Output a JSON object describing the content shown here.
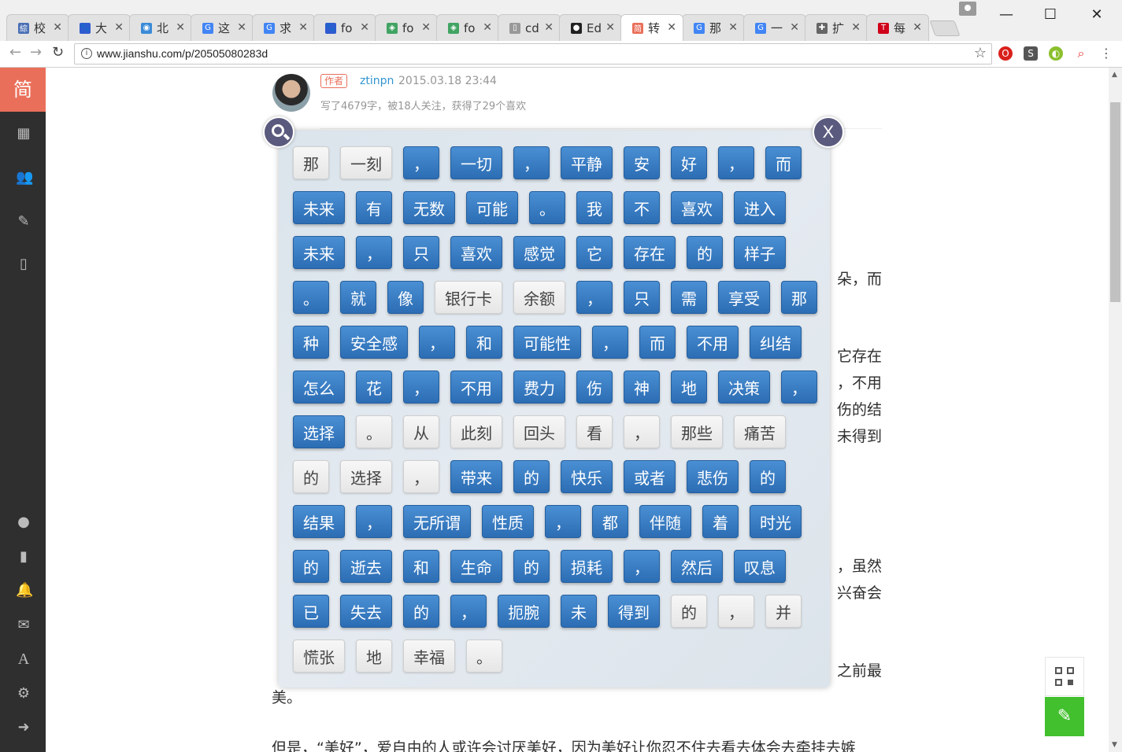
{
  "browser": {
    "tabs": [
      {
        "label": "校",
        "fav_color": "#4a6fb5",
        "fav": "綜"
      },
      {
        "label": "大",
        "fav_color": "#2f5bd0",
        "fav": "🐾"
      },
      {
        "label": "北",
        "fav_color": "#3a8ad8",
        "fav": "◉"
      },
      {
        "label": "这",
        "fav_color": "#4285f4",
        "fav": "G"
      },
      {
        "label": "求",
        "fav_color": "#4285f4",
        "fav": "G"
      },
      {
        "label": "fo",
        "fav_color": "#2f5bd0",
        "fav": "🐾"
      },
      {
        "label": "fo",
        "fav_color": "#41a463",
        "fav": "◈"
      },
      {
        "label": "fo",
        "fav_color": "#41a463",
        "fav": "◈"
      },
      {
        "label": "cd",
        "fav_color": "#999999",
        "fav": "▯"
      },
      {
        "label": "Ed",
        "fav_color": "#222222",
        "fav": "●"
      },
      {
        "label": "转",
        "fav_color": "#ea6f5a",
        "fav": "简"
      },
      {
        "label": "那",
        "fav_color": "#4285f4",
        "fav": "G"
      },
      {
        "label": "一",
        "fav_color": "#4285f4",
        "fav": "G"
      },
      {
        "label": "扩",
        "fav_color": "#666666",
        "fav": "✚"
      },
      {
        "label": "每",
        "fav_color": "#d0021b",
        "fav": "T"
      }
    ],
    "active_tab_index": 10,
    "url": "www.jianshu.com/p/20505080283d",
    "window_buttons": {
      "minimize": "—",
      "maximize": "☐",
      "close": "✕"
    }
  },
  "sidebar": {
    "logo": "简"
  },
  "article": {
    "author_badge": "作者",
    "author_name": "ztinpn",
    "date": "2015.03.18 23:44",
    "stats": "写了4679字，被18人关注，获得了29个喜欢",
    "fragments": {
      "r1": "朵，而",
      "r2": "它存在",
      "r3": "，不用",
      "r4": "伤的结",
      "r5": "未得到",
      "r6": "，虽然",
      "r7": "兴奋会",
      "r8": "之前最",
      "r9": "美。",
      "r10": "但是，“美好”，爱自由的人或许会讨厌美好，因为美好让你忍不住去看去体会去牵挂去嫉"
    }
  },
  "overlay": {
    "rows": [
      [
        {
          "t": "那",
          "on": false
        },
        {
          "t": "一刻",
          "on": false
        },
        {
          "t": "，",
          "on": true
        },
        {
          "t": "一切",
          "on": true
        },
        {
          "t": "，",
          "on": true
        },
        {
          "t": "平静",
          "on": true
        },
        {
          "t": "安",
          "on": true
        },
        {
          "t": "好",
          "on": true
        },
        {
          "t": "，",
          "on": true
        },
        {
          "t": "而",
          "on": true
        }
      ],
      [
        {
          "t": "未来",
          "on": true
        },
        {
          "t": "有",
          "on": true
        },
        {
          "t": "无数",
          "on": true
        },
        {
          "t": "可能",
          "on": true
        },
        {
          "t": "。",
          "on": true
        },
        {
          "t": "我",
          "on": true
        },
        {
          "t": "不",
          "on": true
        },
        {
          "t": "喜欢",
          "on": true
        },
        {
          "t": "进入",
          "on": true
        }
      ],
      [
        {
          "t": "未来",
          "on": true
        },
        {
          "t": "，",
          "on": true
        },
        {
          "t": "只",
          "on": true
        },
        {
          "t": "喜欢",
          "on": true
        },
        {
          "t": "感觉",
          "on": true
        },
        {
          "t": "它",
          "on": true
        },
        {
          "t": "存在",
          "on": true
        },
        {
          "t": "的",
          "on": true
        },
        {
          "t": "样子",
          "on": true
        }
      ],
      [
        {
          "t": "。",
          "on": true
        },
        {
          "t": "就",
          "on": true
        },
        {
          "t": "像",
          "on": true
        },
        {
          "t": "银行卡",
          "on": false
        },
        {
          "t": "余额",
          "on": false
        },
        {
          "t": "，",
          "on": true
        },
        {
          "t": "只",
          "on": true
        },
        {
          "t": "需",
          "on": true
        },
        {
          "t": "享受",
          "on": true
        },
        {
          "t": "那",
          "on": true
        }
      ],
      [
        {
          "t": "种",
          "on": true
        },
        {
          "t": "安全感",
          "on": true
        },
        {
          "t": "，",
          "on": true
        },
        {
          "t": "和",
          "on": true
        },
        {
          "t": "可能性",
          "on": true
        },
        {
          "t": "，",
          "on": true
        },
        {
          "t": "而",
          "on": true
        },
        {
          "t": "不用",
          "on": true
        },
        {
          "t": "纠结",
          "on": true
        }
      ],
      [
        {
          "t": "怎么",
          "on": true
        },
        {
          "t": "花",
          "on": true
        },
        {
          "t": "，",
          "on": true
        },
        {
          "t": "不用",
          "on": true
        },
        {
          "t": "费力",
          "on": true
        },
        {
          "t": "伤",
          "on": true
        },
        {
          "t": "神",
          "on": true
        },
        {
          "t": "地",
          "on": true
        },
        {
          "t": "决策",
          "on": true
        },
        {
          "t": "，",
          "on": true
        }
      ],
      [
        {
          "t": "选择",
          "on": true
        },
        {
          "t": "。",
          "on": false
        },
        {
          "t": "从",
          "on": false
        },
        {
          "t": "此刻",
          "on": false
        },
        {
          "t": "回头",
          "on": false
        },
        {
          "t": "看",
          "on": false
        },
        {
          "t": "，",
          "on": false
        },
        {
          "t": "那些",
          "on": false
        },
        {
          "t": "痛苦",
          "on": false
        }
      ],
      [
        {
          "t": "的",
          "on": false
        },
        {
          "t": "选择",
          "on": false
        },
        {
          "t": "，",
          "on": false
        },
        {
          "t": "带来",
          "on": true
        },
        {
          "t": "的",
          "on": true
        },
        {
          "t": "快乐",
          "on": true
        },
        {
          "t": "或者",
          "on": true
        },
        {
          "t": "悲伤",
          "on": true
        },
        {
          "t": "的",
          "on": true
        }
      ],
      [
        {
          "t": "结果",
          "on": true
        },
        {
          "t": "，",
          "on": true
        },
        {
          "t": "无所谓",
          "on": true
        },
        {
          "t": "性质",
          "on": true
        },
        {
          "t": "，",
          "on": true
        },
        {
          "t": "都",
          "on": true
        },
        {
          "t": "伴随",
          "on": true
        },
        {
          "t": "着",
          "on": true
        },
        {
          "t": "时光",
          "on": true
        }
      ],
      [
        {
          "t": "的",
          "on": true
        },
        {
          "t": "逝去",
          "on": true
        },
        {
          "t": "和",
          "on": true
        },
        {
          "t": "生命",
          "on": true
        },
        {
          "t": "的",
          "on": true
        },
        {
          "t": "损耗",
          "on": true
        },
        {
          "t": "，",
          "on": true
        },
        {
          "t": "然后",
          "on": true
        },
        {
          "t": "叹息",
          "on": true
        }
      ],
      [
        {
          "t": "已",
          "on": true
        },
        {
          "t": "失去",
          "on": true
        },
        {
          "t": "的",
          "on": true
        },
        {
          "t": "，",
          "on": true
        },
        {
          "t": "扼腕",
          "on": true
        },
        {
          "t": "未",
          "on": true
        },
        {
          "t": "得到",
          "on": true
        },
        {
          "t": "的",
          "on": false
        },
        {
          "t": "，",
          "on": false
        },
        {
          "t": "并",
          "on": false
        }
      ],
      [
        {
          "t": "慌张",
          "on": false
        },
        {
          "t": "地",
          "on": false
        },
        {
          "t": "幸福",
          "on": false
        },
        {
          "t": "。",
          "on": false
        }
      ]
    ],
    "close_label": "X"
  }
}
